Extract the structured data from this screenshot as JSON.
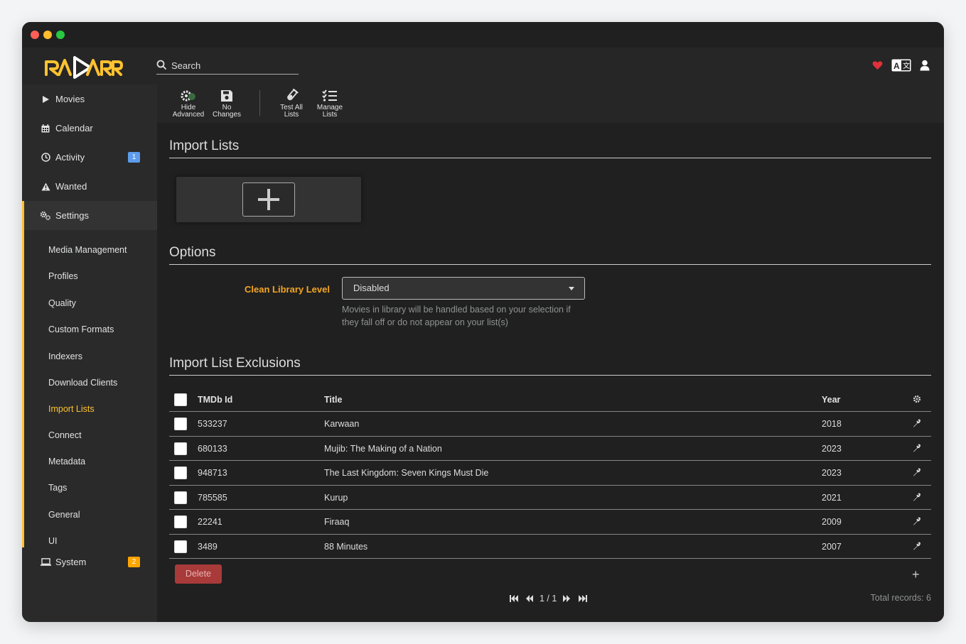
{
  "app": {
    "name": "Radarr",
    "accent": "#ffc230"
  },
  "header": {
    "search_placeholder": "Search",
    "icons": [
      "heart-icon",
      "translate-icon",
      "user-icon"
    ]
  },
  "sidebar": {
    "items": [
      {
        "label": "Movies",
        "icon": "play-icon"
      },
      {
        "label": "Calendar",
        "icon": "calendar-icon"
      },
      {
        "label": "Activity",
        "icon": "clock-icon",
        "badge": "1"
      },
      {
        "label": "Wanted",
        "icon": "warning-icon"
      },
      {
        "label": "Settings",
        "icon": "cogs-icon"
      },
      {
        "label": "System",
        "icon": "laptop-icon",
        "badge": "2"
      }
    ],
    "settings_sub": [
      "Media Management",
      "Profiles",
      "Quality",
      "Custom Formats",
      "Indexers",
      "Download Clients",
      "Import Lists",
      "Connect",
      "Metadata",
      "Tags",
      "General",
      "UI"
    ]
  },
  "toolbar": {
    "hide_advanced": [
      "Hide",
      "Advanced"
    ],
    "no_changes": [
      "No",
      "Changes"
    ],
    "test_all": [
      "Test All",
      "Lists"
    ],
    "manage": [
      "Manage",
      "Lists"
    ]
  },
  "import_lists": {
    "title": "Import Lists"
  },
  "options": {
    "title": "Options",
    "clean_label": "Clean Library Level",
    "clean_value": "Disabled",
    "help": "Movies in library will be handled based on your selection if they fall off or do not appear on your list(s)"
  },
  "exclusions": {
    "title": "Import List Exclusions",
    "columns": {
      "id": "TMDb Id",
      "title": "Title",
      "year": "Year"
    },
    "rows": [
      {
        "id": "533237",
        "title": "Karwaan",
        "year": "2018"
      },
      {
        "id": "680133",
        "title": "Mujib: The Making of a Nation",
        "year": "2023"
      },
      {
        "id": "948713",
        "title": "The Last Kingdom: Seven Kings Must Die",
        "year": "2023"
      },
      {
        "id": "785585",
        "title": "Kurup",
        "year": "2021"
      },
      {
        "id": "22241",
        "title": "Firaaq",
        "year": "2009"
      },
      {
        "id": "3489",
        "title": "88 Minutes",
        "year": "2007"
      }
    ],
    "delete_label": "Delete",
    "page": "1 / 1",
    "total": "Total records: 6"
  }
}
